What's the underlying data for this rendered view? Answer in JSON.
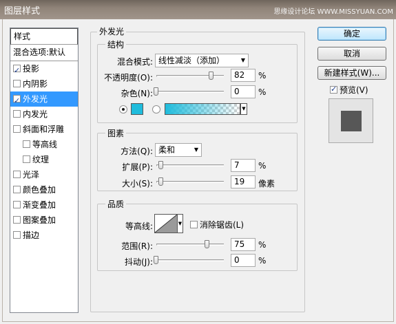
{
  "window": {
    "title": "图层样式",
    "watermark": "思缘设计论坛 WWW.MISSYUAN.COM"
  },
  "stylelist": {
    "header": "样式",
    "blend": "混合选项:默认",
    "items": [
      {
        "label": "投影",
        "checked": true
      },
      {
        "label": "内阴影",
        "checked": false
      },
      {
        "label": "外发光",
        "checked": true,
        "selected": true
      },
      {
        "label": "内发光",
        "checked": false
      },
      {
        "label": "斜面和浮雕",
        "checked": false
      },
      {
        "label": "等高线",
        "checked": false,
        "indent": true
      },
      {
        "label": "纹理",
        "checked": false,
        "indent": true
      },
      {
        "label": "光泽",
        "checked": false
      },
      {
        "label": "颜色叠加",
        "checked": false
      },
      {
        "label": "渐变叠加",
        "checked": false
      },
      {
        "label": "图案叠加",
        "checked": false
      },
      {
        "label": "描边",
        "checked": false
      }
    ]
  },
  "outer_glow": {
    "title": "外发光",
    "structure": {
      "title": "结构",
      "blend_mode_label": "混合模式:",
      "blend_mode_value": "线性减淡（添加）",
      "opacity_label": "不透明度(O):",
      "opacity_value": "82",
      "opacity_fraction": 0.82,
      "opacity_unit": "%",
      "noise_label": "杂色(N):",
      "noise_value": "0",
      "noise_fraction": 0.0,
      "noise_unit": "%",
      "glow_color": "#20bcdc",
      "color_mode": "solid"
    },
    "elements": {
      "title": "图素",
      "technique_label": "方法(Q):",
      "technique_value": "柔和",
      "spread_label": "扩展(P):",
      "spread_value": "7",
      "spread_fraction": 0.07,
      "spread_unit": "%",
      "size_label": "大小(S):",
      "size_value": "19",
      "size_fraction": 0.076,
      "size_unit": "像素"
    },
    "quality": {
      "title": "品质",
      "contour_label": "等高线:",
      "antialias_label": "消除锯齿(L)",
      "antialias_checked": false,
      "range_label": "范围(R):",
      "range_value": "75",
      "range_fraction": 0.75,
      "range_unit": "%",
      "jitter_label": "抖动(J):",
      "jitter_value": "0",
      "jitter_fraction": 0.0,
      "jitter_unit": "%"
    }
  },
  "buttons": {
    "ok": "确定",
    "cancel": "取消",
    "new_style": "新建样式(W)...",
    "preview_label": "预览(V)",
    "preview_checked": true
  }
}
